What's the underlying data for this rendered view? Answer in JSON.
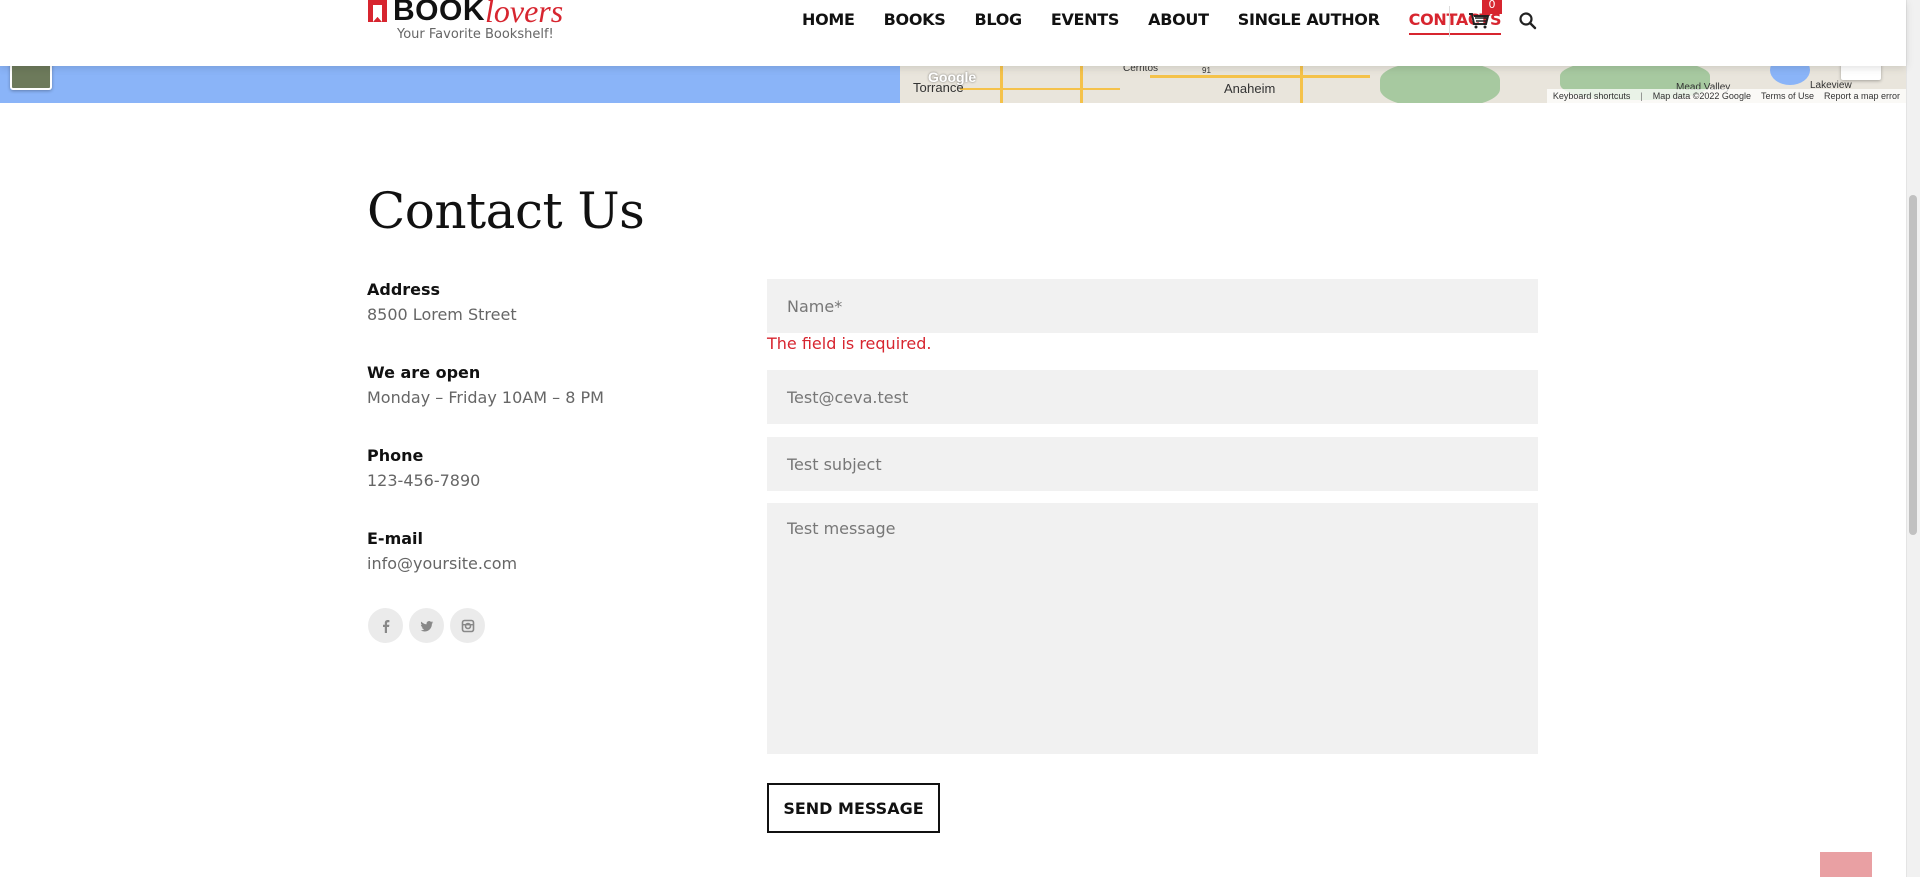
{
  "brand": {
    "name_part1": "BOOK",
    "name_part2": "lovers",
    "tagline": "Your Favorite Bookshelf!",
    "accent": "#d7252f"
  },
  "nav": {
    "items": [
      {
        "label": "HOME"
      },
      {
        "label": "BOOKS"
      },
      {
        "label": "BLOG"
      },
      {
        "label": "EVENTS"
      },
      {
        "label": "ABOUT"
      },
      {
        "label": "SINGLE AUTHOR"
      },
      {
        "label": "CONTACTS",
        "active": true
      }
    ],
    "cart_count": "0"
  },
  "map": {
    "labels": {
      "torrance": "Torrance",
      "cerritos": "Cerritos",
      "anaheim": "Anaheim",
      "mead_valley": "Mead Valley",
      "lakeview": "Lakeview",
      "google": "Google",
      "route": "91"
    },
    "footer": {
      "shortcuts": "Keyboard shortcuts",
      "separator": "|",
      "map_data": "Map data ©2022 Google",
      "terms": "Terms of Use",
      "report": "Report a map error"
    }
  },
  "page": {
    "title": "Contact Us"
  },
  "contact_info": [
    {
      "label": "Address",
      "value": "8500 Lorem Street"
    },
    {
      "label": "We are open",
      "value": "Monday – Friday 10AM – 8 PM"
    },
    {
      "label": "Phone",
      "value": "123-456-7890"
    },
    {
      "label": "E-mail",
      "value": "info@yoursite.com"
    }
  ],
  "socials": [
    "facebook-icon",
    "twitter-icon",
    "instagram-icon"
  ],
  "form": {
    "name_placeholder": "Name*",
    "error": "The field is required.",
    "email_value": "Test@ceva.test",
    "subject_value": "Test subject",
    "message_value": "Test message",
    "submit_label": "SEND MESSAGE"
  }
}
